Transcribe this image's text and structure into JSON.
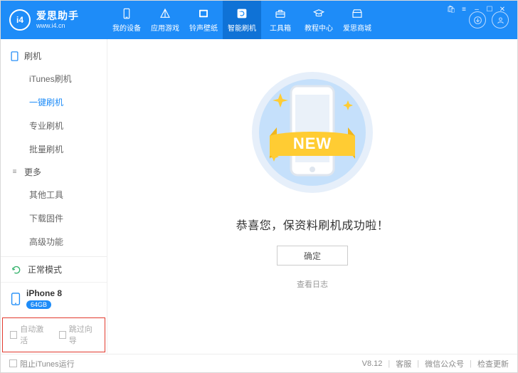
{
  "logo": {
    "badge": "i4",
    "title": "爱思助手",
    "sub": "www.i4.cn"
  },
  "nav": [
    {
      "id": "device",
      "label": "我的设备"
    },
    {
      "id": "apps",
      "label": "应用游戏"
    },
    {
      "id": "ring",
      "label": "铃声壁纸"
    },
    {
      "id": "flash",
      "label": "智能刷机",
      "active": true
    },
    {
      "id": "tools",
      "label": "工具箱"
    },
    {
      "id": "guide",
      "label": "教程中心"
    },
    {
      "id": "store",
      "label": "爱思商城"
    }
  ],
  "window_controls": {
    "cart": "⚙",
    "menu": "≡",
    "min": "–",
    "max": "☐",
    "close": "✕"
  },
  "sidebar": {
    "groups": [
      {
        "id": "flash",
        "title": "刷机",
        "items": [
          {
            "id": "itunes",
            "label": "iTunes刷机"
          },
          {
            "id": "oneclick",
            "label": "一键刷机",
            "active": true
          },
          {
            "id": "pro",
            "label": "专业刷机"
          },
          {
            "id": "batch",
            "label": "批量刷机"
          }
        ]
      },
      {
        "id": "more",
        "title": "更多",
        "items": [
          {
            "id": "other",
            "label": "其他工具"
          },
          {
            "id": "fw",
            "label": "下载固件"
          },
          {
            "id": "adv",
            "label": "高级功能"
          }
        ]
      }
    ],
    "mode": {
      "label": "正常模式"
    },
    "device": {
      "name": "iPhone 8",
      "storage": "64GB"
    },
    "activation": {
      "auto": "自动激活",
      "skip": "跳过向导"
    }
  },
  "main": {
    "ribbon": "NEW",
    "message": "恭喜您，保资料刷机成功啦！",
    "ok": "确定",
    "log": "查看日志"
  },
  "status": {
    "block": "阻止iTunes运行",
    "version": "V8.12",
    "support": "客服",
    "wechat": "微信公众号",
    "update": "检查更新"
  }
}
